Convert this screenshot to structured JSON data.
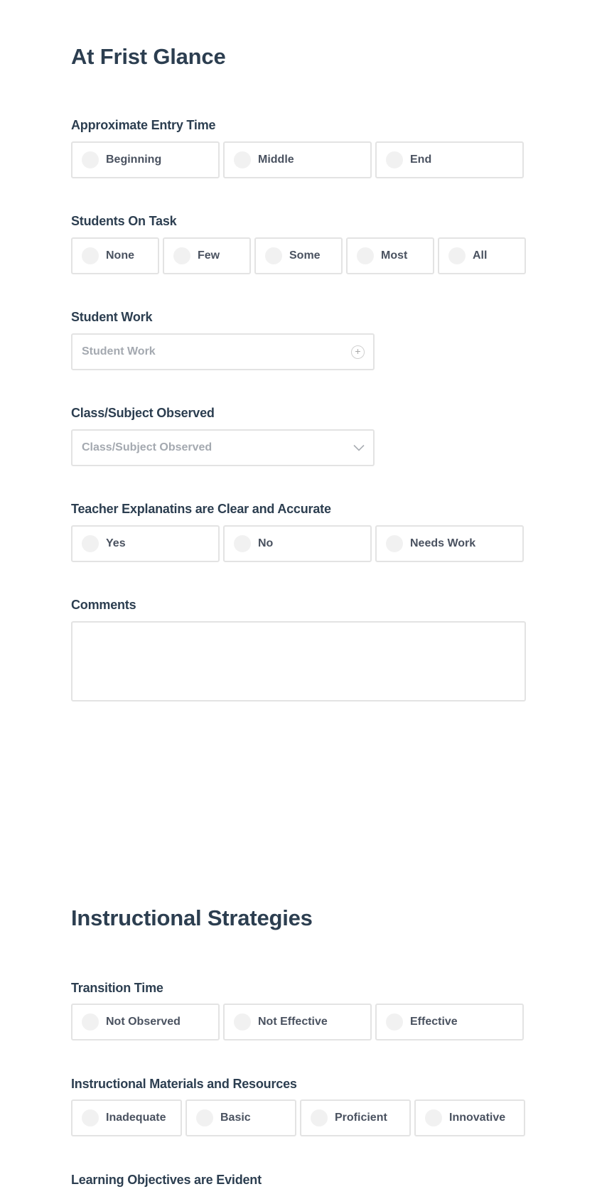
{
  "sections": [
    {
      "title": "At Frist Glance",
      "fields": [
        {
          "label": "Approximate Entry Time",
          "type": "radio",
          "options": [
            "Beginning",
            "Middle",
            "End"
          ]
        },
        {
          "label": "Students On Task",
          "type": "radio",
          "options": [
            "None",
            "Few",
            "Some",
            "Most",
            "All"
          ]
        },
        {
          "label": "Student Work",
          "type": "input-add",
          "placeholder": "Student Work",
          "icon": "plus-circle-icon"
        },
        {
          "label": "Class/Subject Observed",
          "type": "select",
          "placeholder": "Class/Subject Observed",
          "icon": "chevron-down-icon"
        },
        {
          "label": "Teacher Explanatins are Clear and Accurate",
          "type": "radio",
          "options": [
            "Yes",
            "No",
            "Needs Work"
          ]
        },
        {
          "label": "Comments",
          "type": "textarea",
          "value": ""
        }
      ]
    },
    {
      "title": "Instructional Strategies",
      "fields": [
        {
          "label": "Transition Time",
          "type": "radio",
          "options": [
            "Not Observed",
            "Not Effective",
            "Effective"
          ]
        },
        {
          "label": "Instructional Materials and Resources",
          "type": "radio",
          "options": [
            "Inadequate",
            "Basic",
            "Proficient",
            "Innovative"
          ]
        },
        {
          "label": "Learning Objectives are Evident",
          "type": "radio",
          "options": []
        }
      ]
    }
  ],
  "plus_glyph": "+"
}
